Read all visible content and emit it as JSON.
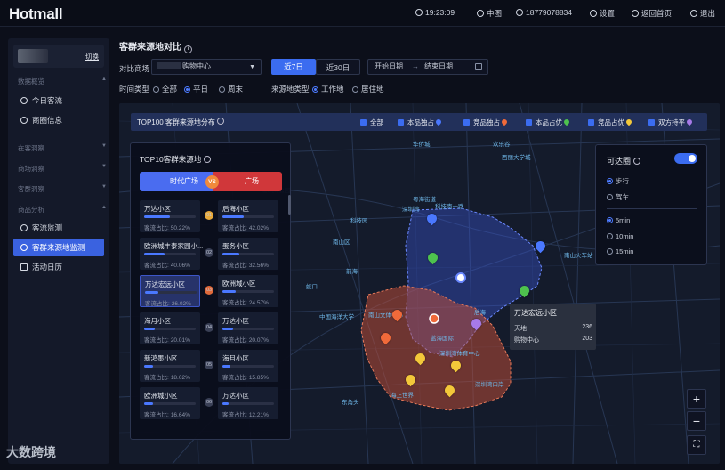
{
  "app": {
    "logo": "Hotmall"
  },
  "topbar": {
    "time": "19:23:09",
    "lang": "中图",
    "phone": "18779078834",
    "settings": "设置",
    "home": "返回首页",
    "logout": "退出"
  },
  "sidebar": {
    "switch": "切换",
    "sections": [
      {
        "title": "数据概览",
        "items": [
          {
            "label": "今日客流"
          },
          {
            "label": "商圈信息"
          }
        ]
      },
      {
        "title": "在客洞察"
      },
      {
        "title": "商场洞察"
      },
      {
        "title": "客群洞察"
      },
      {
        "title": "商品分析",
        "items": [
          {
            "label": "客流监测"
          },
          {
            "label": "客群来源地监测",
            "active": true
          },
          {
            "label": "活动日历"
          }
        ]
      }
    ]
  },
  "main": {
    "title": "客群来源地对比",
    "compare_label": "对比商场",
    "mall_select": "购物中心",
    "range_tabs": [
      {
        "label": "近7日",
        "active": true
      },
      {
        "label": "近30日",
        "active": false
      }
    ],
    "date_start": "开始日期",
    "date_arrow": "→",
    "date_end": "结束日期",
    "time_type_label": "时间类型",
    "time_types": [
      {
        "label": "全部",
        "on": false
      },
      {
        "label": "平日",
        "on": true
      },
      {
        "label": "周末",
        "on": false
      }
    ],
    "source_type_label": "来源地类型",
    "source_types": [
      {
        "label": "工作地",
        "on": true
      },
      {
        "label": "居住地",
        "on": false
      }
    ]
  },
  "filterbar": {
    "title": "TOP100 客群来源地分布",
    "items": [
      {
        "label": "全部",
        "color": ""
      },
      {
        "label": "本品独占",
        "color": "#4a78ff"
      },
      {
        "label": "竞品独占",
        "color": "#f06a3a"
      },
      {
        "label": "本品占优",
        "color": "#4ec24e"
      },
      {
        "label": "竞品占优",
        "color": "#f3c83a"
      },
      {
        "label": "双方持平",
        "color": "#a77ae8"
      }
    ]
  },
  "top10": {
    "title": "TOP10客群来源地",
    "left_name": "时代广场",
    "vs": "VS",
    "right_name": "广场",
    "share_label": "客流占比:",
    "rows": [
      {
        "rank": "01",
        "left": {
          "name": "万达小区",
          "pct": "50.22%",
          "val": 0.5022
        },
        "right": {
          "name": "后海小区",
          "pct": "42.02%",
          "val": 0.4202
        }
      },
      {
        "rank": "02",
        "left": {
          "name": "欧洲城丰泰家园小...",
          "pct": "40.06%",
          "val": 0.4006
        },
        "right": {
          "name": "蛋务小区",
          "pct": "32.56%",
          "val": 0.3256
        }
      },
      {
        "rank": "03",
        "left": {
          "name": "万达宏远小区",
          "pct": "26.02%",
          "val": 0.2602,
          "highlight": true
        },
        "right": {
          "name": "欧洲城小区",
          "pct": "24.57%",
          "val": 0.2457
        }
      },
      {
        "rank": "04",
        "left": {
          "name": "海月小区",
          "pct": "20.01%",
          "val": 0.2001
        },
        "right": {
          "name": "万达小区",
          "pct": "20.07%",
          "val": 0.2007
        }
      },
      {
        "rank": "05",
        "left": {
          "name": "新鸿墨小区",
          "pct": "18.02%",
          "val": 0.1802
        },
        "right": {
          "name": "海月小区",
          "pct": "15.85%",
          "val": 0.1585
        }
      },
      {
        "rank": "06",
        "left": {
          "name": "欧洲城小区",
          "pct": "16.64%",
          "val": 0.1664
        },
        "right": {
          "name": "万达小区",
          "pct": "12.21%",
          "val": 0.1221
        }
      }
    ]
  },
  "reach": {
    "title": "可达圈",
    "modes": [
      {
        "label": "步行",
        "on": true
      },
      {
        "label": "驾车",
        "on": false
      }
    ],
    "times": [
      {
        "label": "5min",
        "on": true
      },
      {
        "label": "10min",
        "on": false
      },
      {
        "label": "15min",
        "on": false
      }
    ]
  },
  "tooltip": {
    "title": "万达宏远小区",
    "rows": [
      {
        "name": "天地",
        "value": "236"
      },
      {
        "name": "购物中心",
        "value": "203"
      }
    ]
  },
  "map": {
    "labels": [
      "深圳湾",
      "深圳湾公园",
      "后海",
      "西丽大学城",
      "南山区",
      "粤海街道",
      "蛇口",
      "科技园",
      "前海",
      "南山文体中心",
      "中国海洋大学",
      "海上世界",
      "深圳湾体育中心",
      "蓝海国际",
      "深圳湾口岸",
      "南山火车站",
      "华侨城",
      "欢乐谷",
      "东角头",
      "科技南十路"
    ]
  },
  "watermark": "大数跨境"
}
